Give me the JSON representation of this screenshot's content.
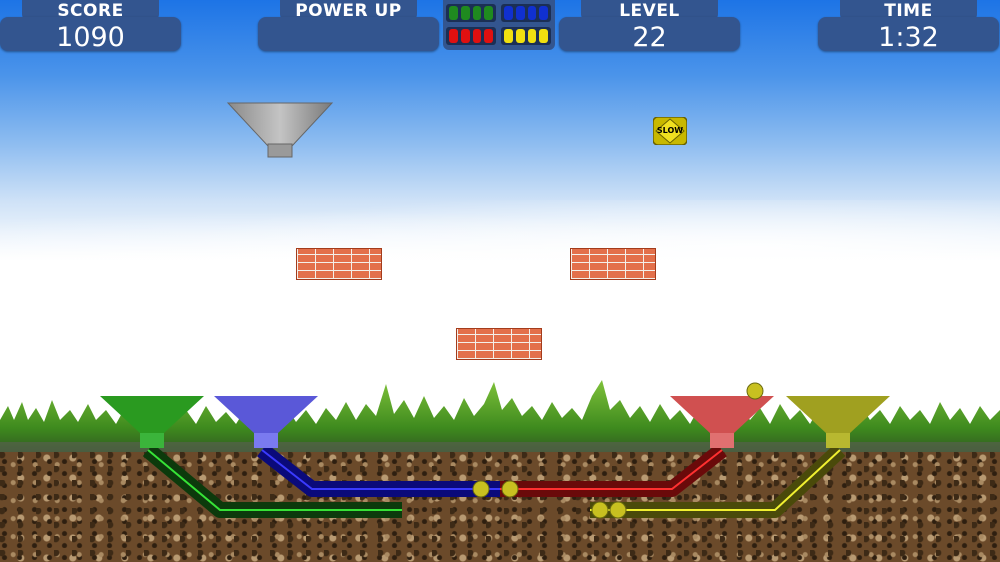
{
  "hud": {
    "score": {
      "label": "SCORE",
      "value": "1090"
    },
    "power_up": {
      "label": "POWER UP",
      "value": ""
    },
    "level": {
      "label": "LEVEL",
      "value": "22"
    },
    "time": {
      "label": "TIME",
      "value": "1:32"
    }
  },
  "ball_indicator": {
    "groups": [
      {
        "color": "green",
        "hex": "#1f8a1f",
        "count": 4
      },
      {
        "color": "blue",
        "hex": "#1030d0",
        "count": 4
      },
      {
        "color": "red",
        "hex": "#e01010",
        "count": 4
      },
      {
        "color": "yellow",
        "hex": "#f0e010",
        "count": 4
      }
    ]
  },
  "powerup_item": {
    "label": "SLOW",
    "icon": "slow-powerup-icon"
  },
  "dispenser": {
    "icon": "grey-funnel-icon"
  },
  "funnels": [
    {
      "color": "green",
      "hex": "#2a9a20"
    },
    {
      "color": "blue",
      "hex": "#5a58d8"
    },
    {
      "color": "red",
      "hex": "#d05050"
    },
    {
      "color": "yellow",
      "hex": "#a0a020"
    }
  ],
  "colors": {
    "hud_panel": "#33558f",
    "ball": "#c8c020"
  }
}
